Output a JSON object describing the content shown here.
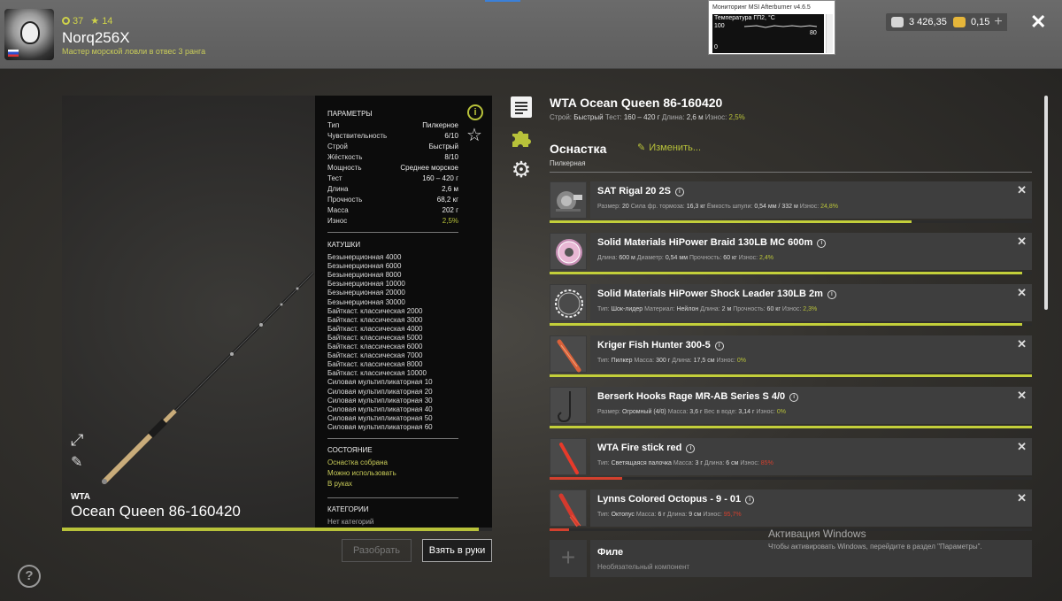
{
  "header": {
    "level": "37",
    "stars": "14",
    "username": "Norq256X",
    "rank_title": "Мастер морской ловли в отвес 3 ранга",
    "silver": "3 426,35",
    "gold": "0,15",
    "add_label": "+",
    "close_label": "✕"
  },
  "msi": {
    "title": "Мониторинг MSI Afterburner v4.6.5",
    "graph_label": "Температура ГП2, °С",
    "y_top": "100",
    "y_bottom": "0",
    "value": "80"
  },
  "rod": {
    "brand": "WTA",
    "name": "Ocean Queen 86-160420",
    "condition_pct": 97
  },
  "params": {
    "section_title": "ПАРАМЕТРЫ",
    "rows": [
      {
        "label": "Тип",
        "value": "Пилкерное"
      },
      {
        "label": "Чувствительность",
        "value": "6/10"
      },
      {
        "label": "Строй",
        "value": "Быстрый"
      },
      {
        "label": "Жёсткость",
        "value": "8/10"
      },
      {
        "label": "Мощность",
        "value": "Среднее морское"
      },
      {
        "label": "Тест",
        "value": "160 – 420 г"
      },
      {
        "label": "Длина",
        "value": "2,6 м"
      },
      {
        "label": "Прочность",
        "value": "68,2 кг"
      },
      {
        "label": "Масса",
        "value": "202 г"
      },
      {
        "label": "Износ",
        "value": "2,5%"
      }
    ]
  },
  "reels": {
    "section_title": "КАТУШКИ",
    "items": [
      "Безынерционная 4000",
      "Безынерционная 6000",
      "Безынерционная 8000",
      "Безынерционная 10000",
      "Безынерционная 20000",
      "Безынерционная 30000",
      "Байткаст. классическая 2000",
      "Байткаст. классическая 3000",
      "Байткаст. классическая 4000",
      "Байткаст. классическая 5000",
      "Байткаст. классическая 6000",
      "Байткаст. классическая 7000",
      "Байткаст. классическая 8000",
      "Байткаст. классическая 10000",
      "Силовая мультипликаторная 10",
      "Силовая мультипликаторная 20",
      "Силовая мультипликаторная 30",
      "Силовая мультипликаторная 40",
      "Силовая мультипликаторная 50",
      "Силовая мультипликаторная 60"
    ]
  },
  "state": {
    "section_title": "СОСТОЯНИЕ",
    "items": [
      "Оснастка собрана",
      "Можно использовать",
      "В руках"
    ]
  },
  "categories": {
    "section_title": "КАТЕГОРИИ",
    "empty": "Нет категорий"
  },
  "buttons": {
    "disassemble": "Разобрать",
    "take": "Взять в руки",
    "help": "?"
  },
  "rod_header": {
    "title": "WTA Ocean Queen 86-160420",
    "fields": [
      {
        "label": "Строй:",
        "value": "Быстрый",
        "tone": "v"
      },
      {
        "label": "Тест:",
        "value": "160 – 420 г",
        "tone": "v"
      },
      {
        "label": "Длина:",
        "value": "2,6 м",
        "tone": "v"
      },
      {
        "label": "Износ:",
        "value": "2,5%",
        "tone": "g"
      }
    ]
  },
  "tackle": {
    "title": "Оснастка",
    "subtitle": "Пилкерная",
    "edit_label": "Изменить...",
    "items": [
      {
        "name": "SAT Rigal 20 2S",
        "icon": "reel-icon",
        "fields": [
          {
            "label": "Размер:",
            "value": "20",
            "tone": "v"
          },
          {
            "label": "Сила фр. тормоза:",
            "value": "16,3 кг",
            "tone": "v"
          },
          {
            "label": "Ёмкость шпули:",
            "value": "0,54 мм / 332 м",
            "tone": "v"
          },
          {
            "label": "Износ:",
            "value": "24,8%",
            "tone": "g"
          }
        ],
        "condition": 0.75,
        "bar_color": "yel"
      },
      {
        "name": "Solid Materials HiPower Braid 130LB MC 600m",
        "icon": "line-spool-icon",
        "fields": [
          {
            "label": "Длина:",
            "value": "600 м",
            "tone": "v"
          },
          {
            "label": "Диаметр:",
            "value": "0,54 мм",
            "tone": "v"
          },
          {
            "label": "Прочность:",
            "value": "60 кг",
            "tone": "v"
          },
          {
            "label": "Износ:",
            "value": "2,4%",
            "tone": "g"
          }
        ],
        "condition": 0.98,
        "bar_color": "yel"
      },
      {
        "name": "Solid Materials HiPower Shock Leader 130LB 2m",
        "icon": "leader-coil-icon",
        "fields": [
          {
            "label": "Тип:",
            "value": "Шок-лидер",
            "tone": "v"
          },
          {
            "label": "Материал:",
            "value": "Нейлон",
            "tone": "v"
          },
          {
            "label": "Длина:",
            "value": "2 м",
            "tone": "v"
          },
          {
            "label": "Прочность:",
            "value": "60 кг",
            "tone": "v"
          },
          {
            "label": "Износ:",
            "value": "2,3%",
            "tone": "g"
          }
        ],
        "condition": 0.98,
        "bar_color": "yel"
      },
      {
        "name": "Kriger Fish Hunter 300-5",
        "icon": "pilker-lure-icon",
        "fields": [
          {
            "label": "Тип:",
            "value": "Пилкер",
            "tone": "v"
          },
          {
            "label": "Масса:",
            "value": "300 г",
            "tone": "v"
          },
          {
            "label": "Длина:",
            "value": "17,5 см",
            "tone": "v"
          },
          {
            "label": "Износ:",
            "value": "0%",
            "tone": "g"
          }
        ],
        "condition": 1.0,
        "bar_color": "yel"
      },
      {
        "name": "Berserk Hooks Rage MR-AB Series S 4/0",
        "icon": "hook-icon",
        "fields": [
          {
            "label": "Размер:",
            "value": "Огромный (4/0)",
            "tone": "v"
          },
          {
            "label": "Масса:",
            "value": "3,6 г",
            "tone": "v"
          },
          {
            "label": "Вес в воде:",
            "value": "3,14 г",
            "tone": "v"
          },
          {
            "label": "Износ:",
            "value": "0%",
            "tone": "g"
          }
        ],
        "condition": 1.0,
        "bar_color": "yel"
      },
      {
        "name": "WTA Fire stick red",
        "icon": "glow-stick-icon",
        "fields": [
          {
            "label": "Тип:",
            "value": "Светящаяся палочка",
            "tone": "v"
          },
          {
            "label": "Масса:",
            "value": "3 г",
            "tone": "v"
          },
          {
            "label": "Длина:",
            "value": "6 см",
            "tone": "v"
          },
          {
            "label": "Износ:",
            "value": "85%",
            "tone": "r"
          }
        ],
        "condition": 0.15,
        "bar_color": "red"
      },
      {
        "name": "Lynns Colored Octopus - 9 - 01",
        "icon": "octopus-lure-icon",
        "fields": [
          {
            "label": "Тип:",
            "value": "Октопус",
            "tone": "v"
          },
          {
            "label": "Масса:",
            "value": "6 г",
            "tone": "v"
          },
          {
            "label": "Длина:",
            "value": "9 см",
            "tone": "v"
          },
          {
            "label": "Износ:",
            "value": "95,7%",
            "tone": "r"
          }
        ],
        "condition": 0.04,
        "bar_color": "red"
      }
    ],
    "optional_slot": {
      "name": "Филе",
      "meta": "Необязательный компонент"
    }
  },
  "windows_activation": {
    "line1": "Активация Windows",
    "line2": "Чтобы активировать Windows, перейдите в раздел \"Параметры\"."
  },
  "colors": {
    "accent": "#b8c23a",
    "danger": "#d3402e"
  }
}
